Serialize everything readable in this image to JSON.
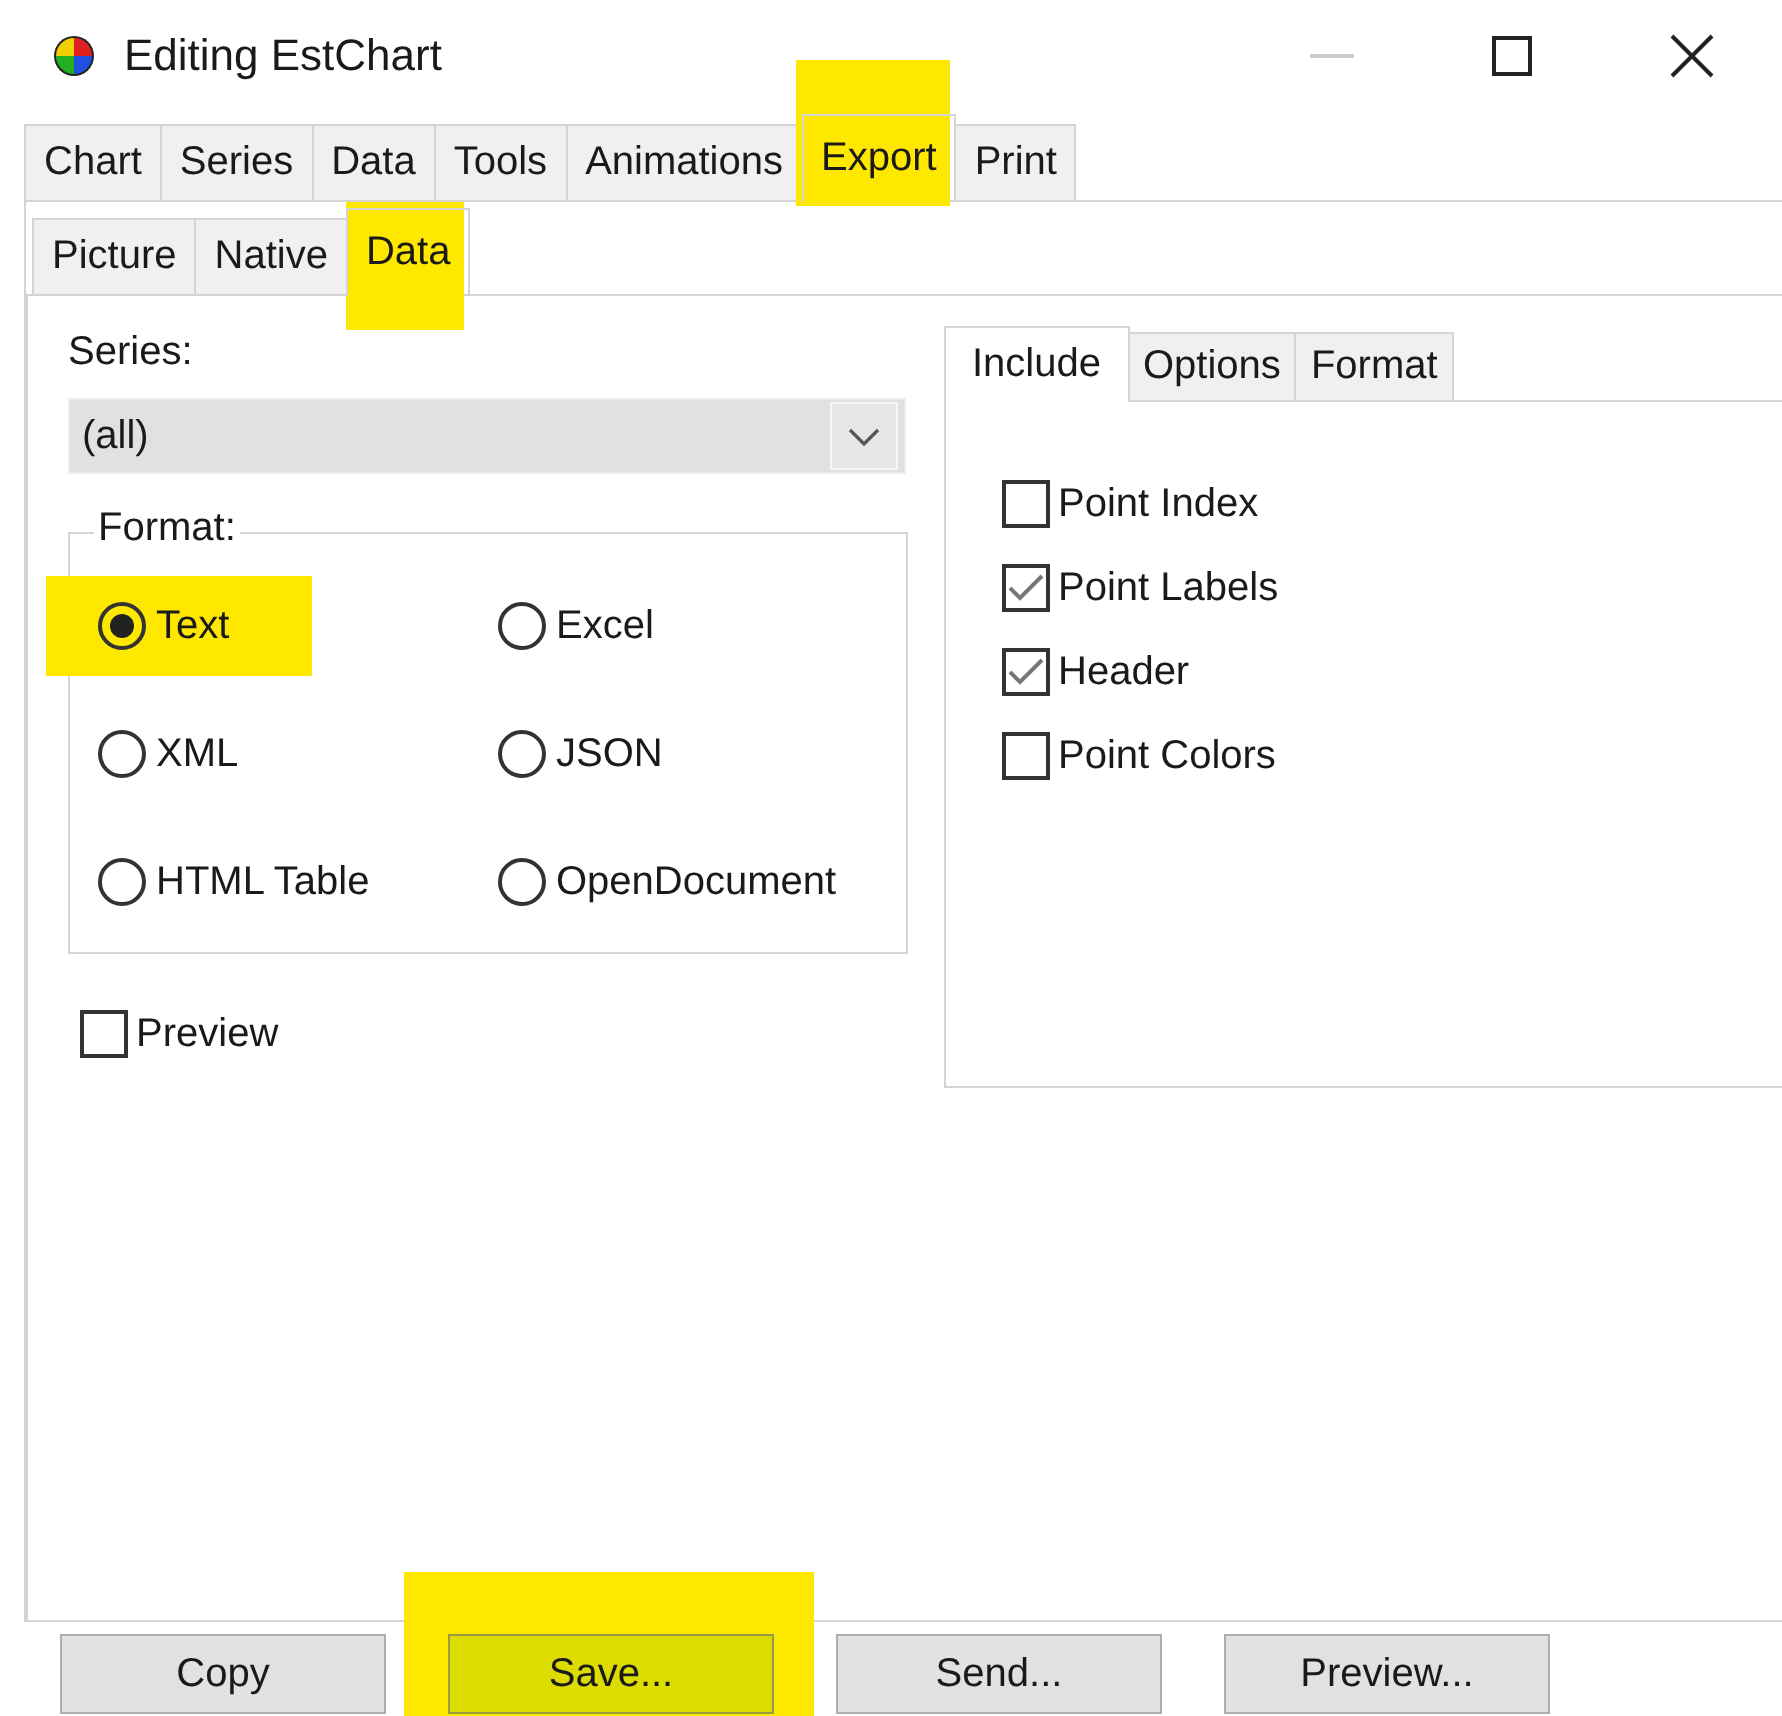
{
  "window": {
    "title": "Editing EstChart"
  },
  "tabs": [
    {
      "label": "Chart",
      "selected": false,
      "highlighted": false
    },
    {
      "label": "Series",
      "selected": false,
      "highlighted": false
    },
    {
      "label": "Data",
      "selected": false,
      "highlighted": false
    },
    {
      "label": "Tools",
      "selected": false,
      "highlighted": false
    },
    {
      "label": "Animations",
      "selected": false,
      "highlighted": false
    },
    {
      "label": "Export",
      "selected": true,
      "highlighted": true
    },
    {
      "label": "Print",
      "selected": false,
      "highlighted": false
    }
  ],
  "subtabs": [
    {
      "label": "Picture",
      "selected": false,
      "highlighted": false
    },
    {
      "label": "Native",
      "selected": false,
      "highlighted": false
    },
    {
      "label": "Data",
      "selected": true,
      "highlighted": true
    }
  ],
  "series": {
    "label": "Series:",
    "value": "(all)"
  },
  "format": {
    "legend": "Format:",
    "options": [
      {
        "label": "Text",
        "selected": true,
        "highlighted": true
      },
      {
        "label": "Excel",
        "selected": false,
        "highlighted": false
      },
      {
        "label": "XML",
        "selected": false,
        "highlighted": false
      },
      {
        "label": "JSON",
        "selected": false,
        "highlighted": false
      },
      {
        "label": "HTML Table",
        "selected": false,
        "highlighted": false
      },
      {
        "label": "OpenDocument",
        "selected": false,
        "highlighted": false
      }
    ]
  },
  "preview": {
    "label": "Preview",
    "checked": false
  },
  "include_tabs": [
    {
      "label": "Include",
      "selected": true
    },
    {
      "label": "Options",
      "selected": false
    },
    {
      "label": "Format",
      "selected": false
    }
  ],
  "include_options": [
    {
      "label": "Point Index",
      "checked": false
    },
    {
      "label": "Point Labels",
      "checked": true
    },
    {
      "label": "Header",
      "checked": true
    },
    {
      "label": "Point Colors",
      "checked": false
    }
  ],
  "buttons": [
    {
      "label": "Copy",
      "highlighted": false
    },
    {
      "label": "Save...",
      "highlighted": true
    },
    {
      "label": "Send...",
      "highlighted": false
    },
    {
      "label": "Preview...",
      "highlighted": false
    }
  ]
}
